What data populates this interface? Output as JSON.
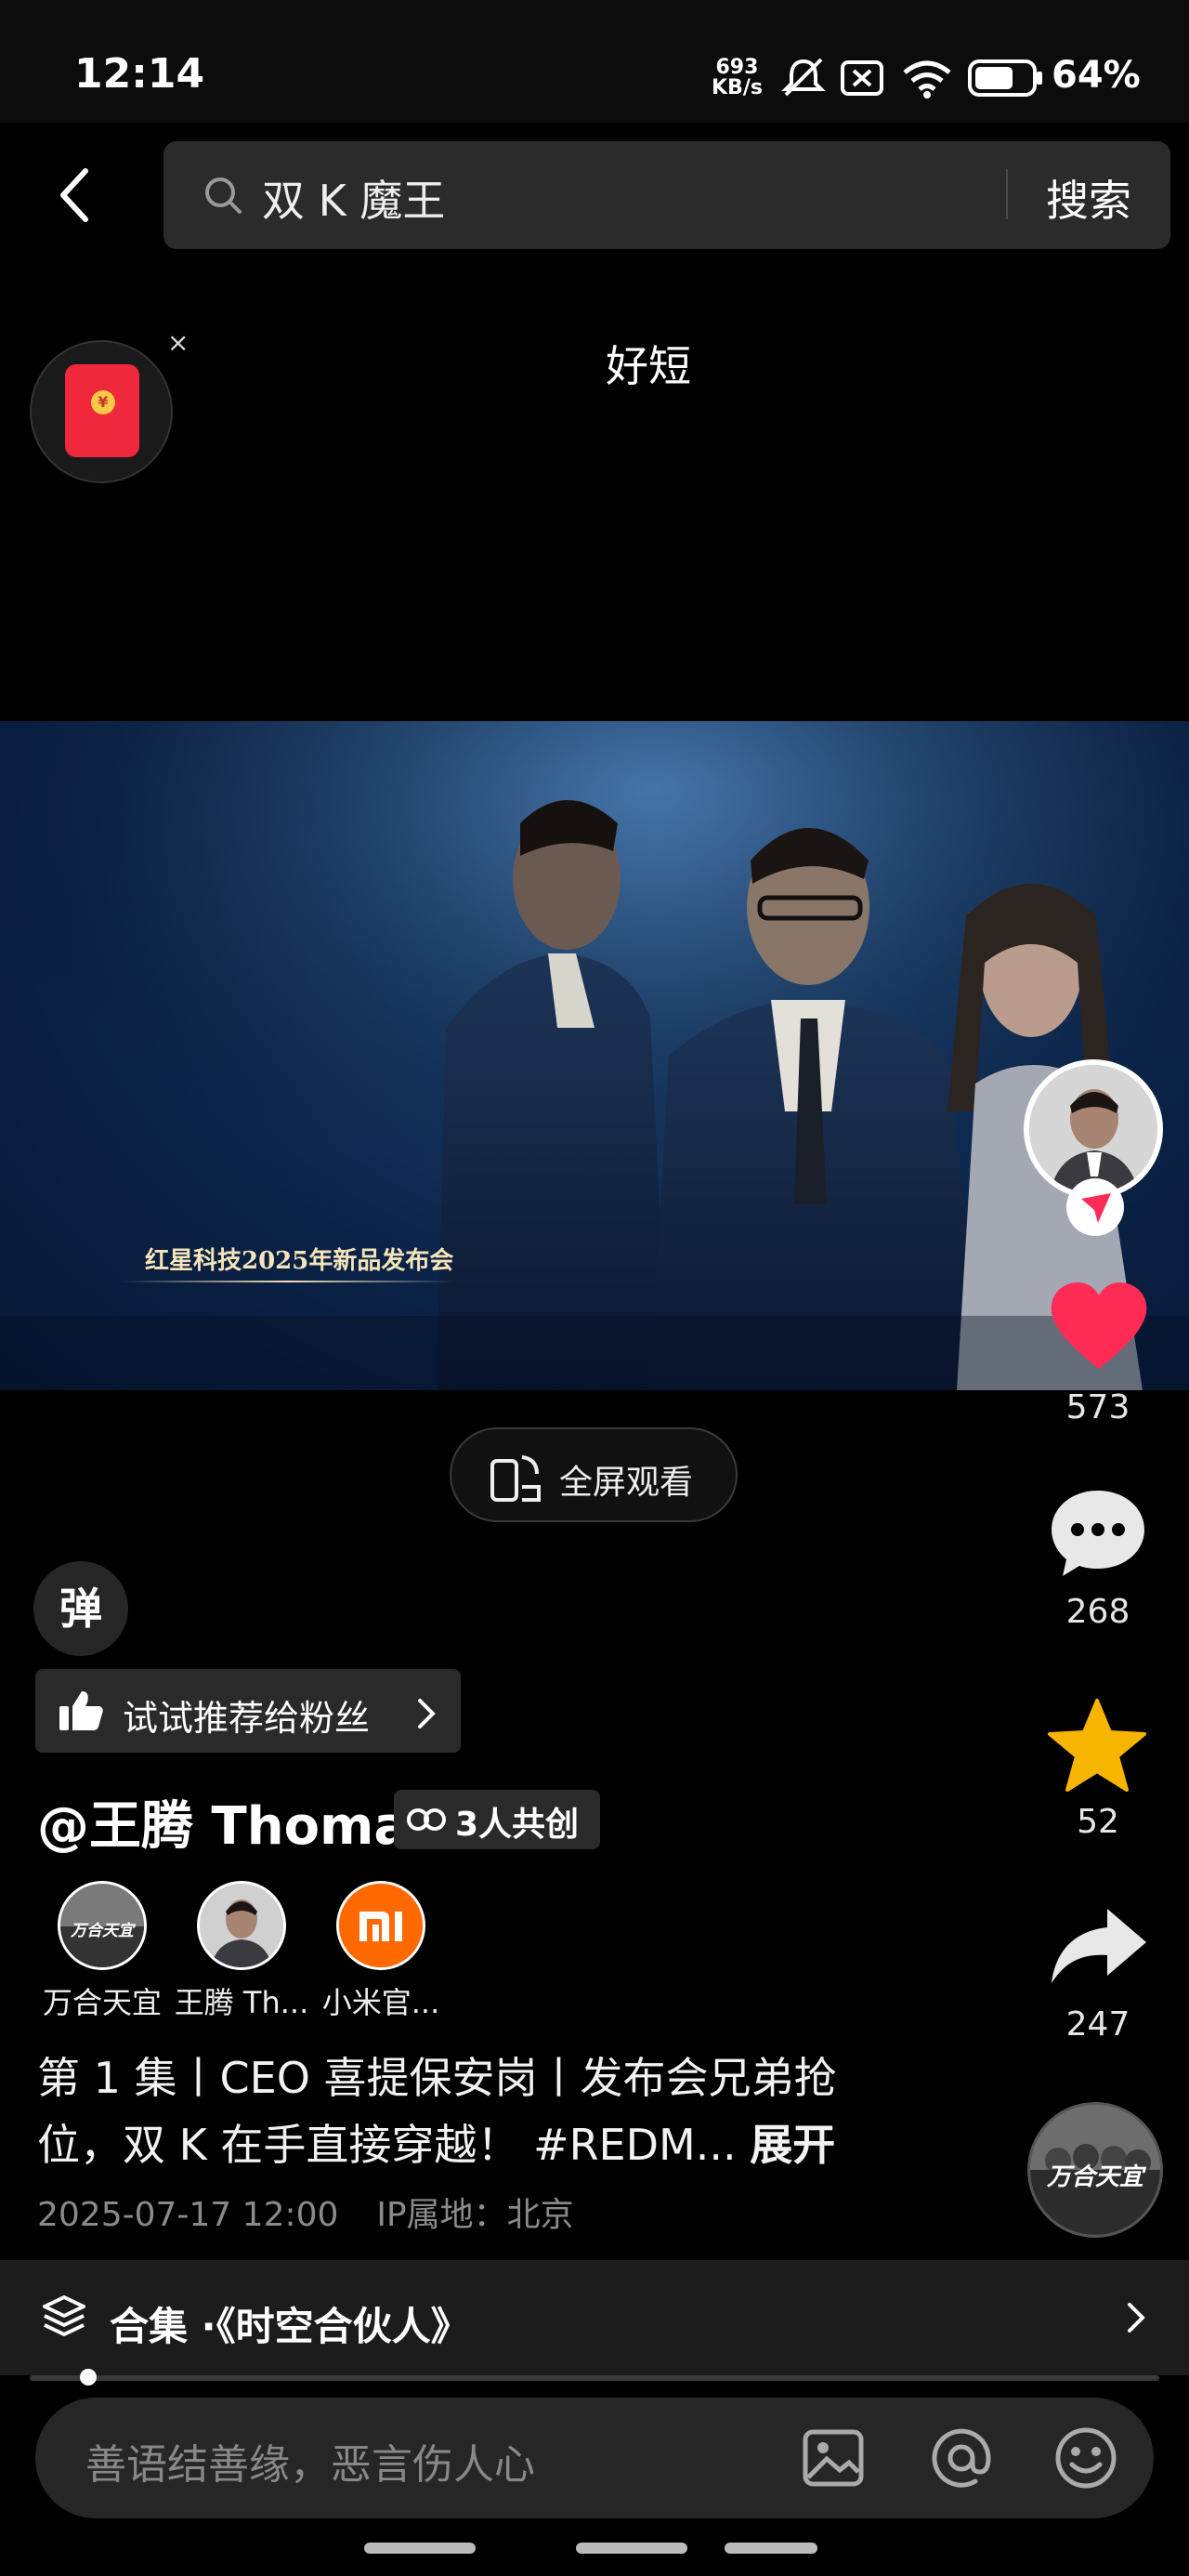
{
  "status_bar": {
    "time": "12:14",
    "net_speed_value": "693",
    "net_speed_unit": "KB/s",
    "battery": "64%"
  },
  "search": {
    "query": "双 K 魔王",
    "button": "搜索"
  },
  "caption_text": "好短",
  "video": {
    "overlay_caption": "红星科技2025年新品发布会"
  },
  "fullscreen_label": "全屏观看",
  "danmaku_label": "弹",
  "actions": {
    "likes": "573",
    "comments": "268",
    "favorites": "52",
    "shares": "247"
  },
  "recommend_label": "试试推荐给粉丝",
  "author": "@王腾 Thomas",
  "cocreate_label": "3人共创",
  "cocreators": [
    {
      "name": "万合天宜"
    },
    {
      "name": "王腾 Th..."
    },
    {
      "name": "小米官..."
    }
  ],
  "description": "第 1 集丨CEO 喜提保安岗丨发布会兄弟抢位，双 K 在手直接穿越！ #REDM...",
  "expand_label": "展开",
  "meta": {
    "date": "2025-07-17 12:00",
    "ip_location": "IP属地：北京"
  },
  "collection_label": "合集 ·《时空合伙人》",
  "comment_placeholder": "善语结善缘，恶言伤人心",
  "watermark_logo_text": "万合天宜",
  "colors": {
    "like": "#fe2c55",
    "star": "#f7b500",
    "xiaomi": "#ff6900",
    "background": "#000000"
  }
}
